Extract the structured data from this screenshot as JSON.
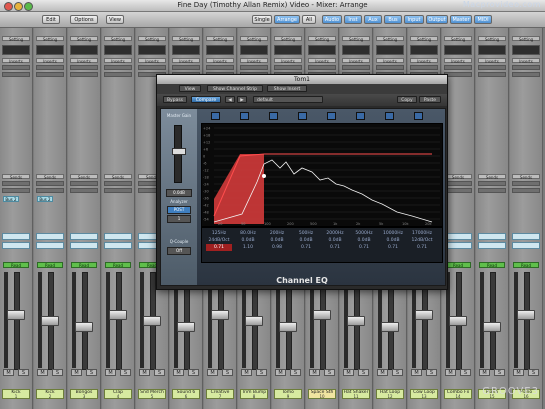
{
  "window": {
    "title": "Fine Day (Timothy Allan Remix) Video - Mixer: Arrange",
    "watermark": "Macprovideo.com"
  },
  "toolbar": {
    "left": [
      "Edit",
      "Options",
      "View"
    ],
    "view_modes": [
      "Single",
      "Arrange",
      "All"
    ],
    "filters": [
      "Audio",
      "Inst",
      "Aux",
      "Bus",
      "Input",
      "Output",
      "Master",
      "MIDI"
    ]
  },
  "strips": [
    {
      "name": "Kick",
      "number": "1",
      "send": "Bus 2"
    },
    {
      "name": "Kick",
      "number": "2",
      "send": "Bus 2"
    },
    {
      "name": "Bongos",
      "number": "3",
      "send": ""
    },
    {
      "name": "Clap",
      "number": "4",
      "send": ""
    },
    {
      "name": "Snd Merch",
      "number": "5",
      "send": ""
    },
    {
      "name": "Sound 6",
      "number": "6",
      "send": ""
    },
    {
      "name": "Creative",
      "number": "7",
      "send": ""
    },
    {
      "name": "Trim Bump",
      "number": "8",
      "send": ""
    },
    {
      "name": "Tomo",
      "number": "9",
      "send": ""
    },
    {
      "name": "Space Sth",
      "number": "10",
      "send": ""
    },
    {
      "name": "Hat Shaker",
      "number": "11",
      "send": ""
    },
    {
      "name": "Hat Loop",
      "number": "12",
      "send": ""
    },
    {
      "name": "Cow Loop",
      "number": "13",
      "send": ""
    },
    {
      "name": "Combo Fx",
      "number": "14",
      "send": ""
    },
    {
      "name": "Piano",
      "number": "15",
      "send": ""
    },
    {
      "name": "Piano",
      "number": "16",
      "send": ""
    }
  ],
  "common": {
    "setting": "Setting",
    "eq": "EQ",
    "inserts": "Inserts",
    "sends": "Sends",
    "read": "Read",
    "off": "Off"
  },
  "plugin": {
    "title": "Tom1",
    "row1": [
      "View",
      "Show Channel Strip",
      "Show Insert"
    ],
    "row2": {
      "bypass": "Bypass",
      "compare": "Compare",
      "preset": "default",
      "copy": "Copy",
      "paste": "Paste"
    },
    "side_labels": [
      "Master Gain",
      "Analyzer",
      "POST",
      "1",
      "Q-Couple",
      "Off"
    ],
    "db_labels": [
      "+24",
      "+18",
      "+12",
      "+6",
      "0",
      "-6",
      "-12",
      "-18",
      "-24",
      "-30",
      "-36",
      "-42",
      "-48",
      "-54"
    ],
    "freq_labels": [
      "20",
      "50",
      "100",
      "200",
      "500",
      "1k",
      "2k",
      "5k",
      "10k",
      "20k"
    ],
    "bands": [
      {
        "freq": "125Hz",
        "gain": "24dB/Oct",
        "q": "0.71"
      },
      {
        "freq": "80.0Hz",
        "gain": "0.0dB",
        "q": "1.10"
      },
      {
        "freq": "200Hz",
        "gain": "0.0dB",
        "q": "0.98"
      },
      {
        "freq": "500Hz",
        "gain": "0.0dB",
        "q": "0.71"
      },
      {
        "freq": "2000Hz",
        "gain": "0.0dB",
        "q": "0.71"
      },
      {
        "freq": "5000Hz",
        "gain": "0.0dB",
        "q": "0.71"
      },
      {
        "freq": "10000Hz",
        "gain": "0.0dB",
        "q": "0.71"
      },
      {
        "freq": "17000Hz",
        "gain": "12dB/Oct",
        "q": "0.71"
      }
    ],
    "name": "Channel EQ"
  },
  "overlay": {
    "brand": "GROOVE3"
  }
}
